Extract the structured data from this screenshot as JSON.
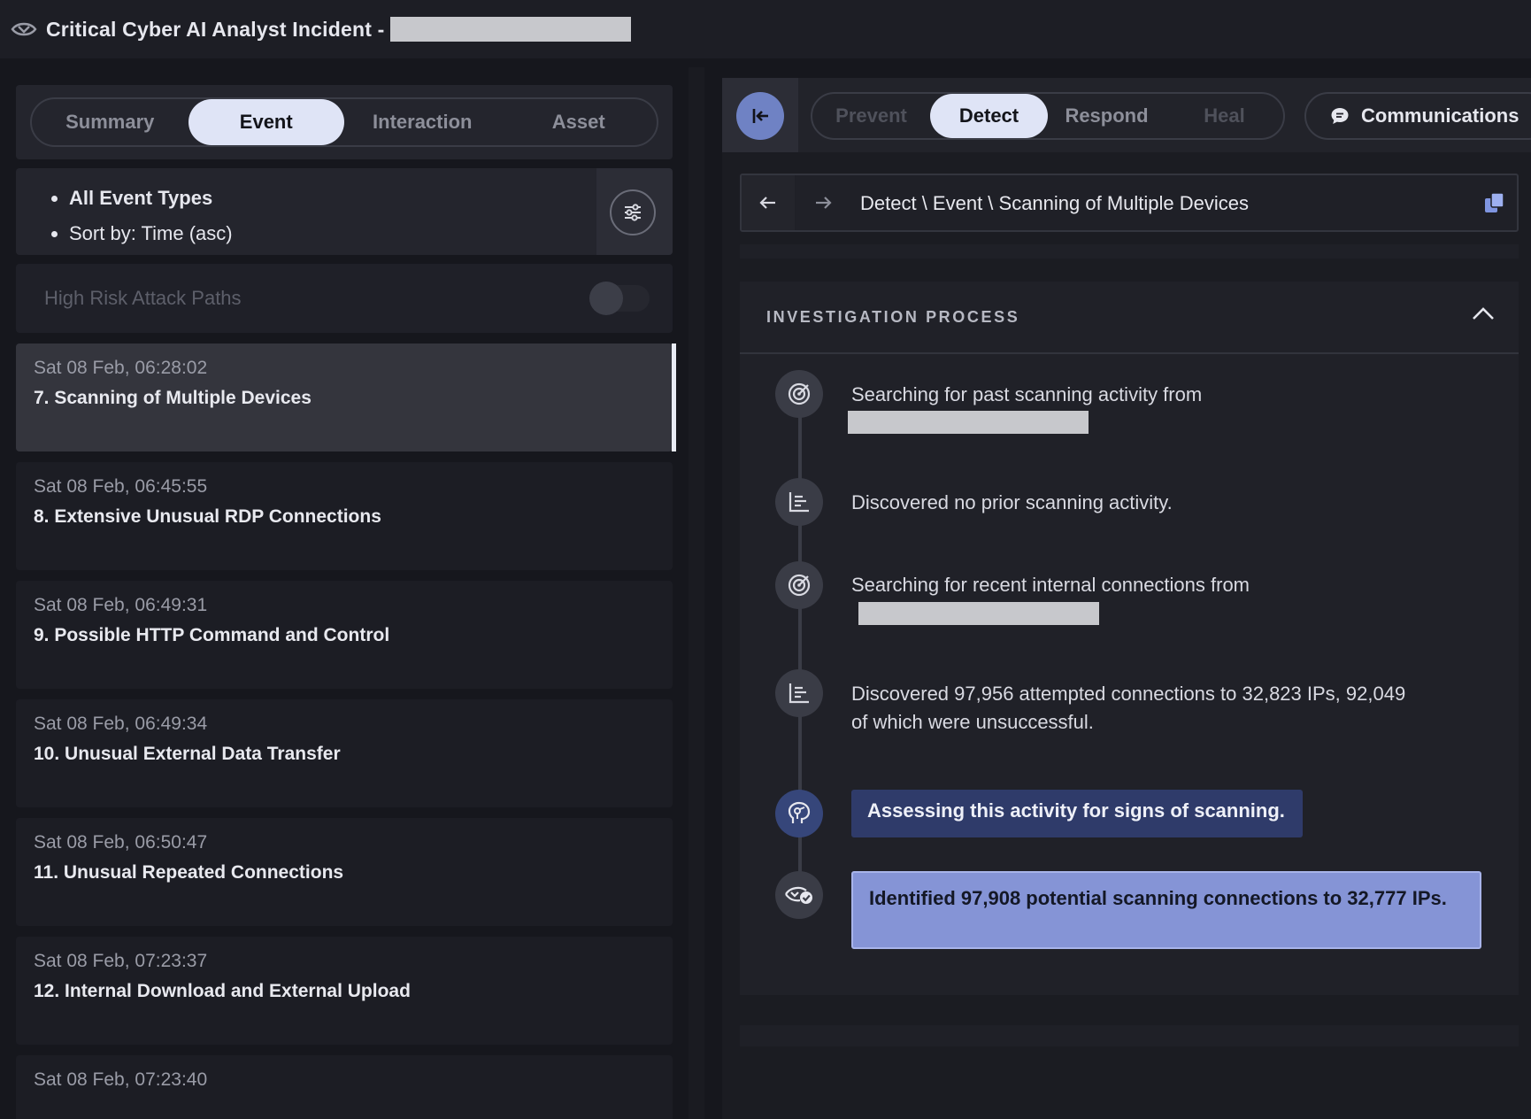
{
  "header": {
    "title": "Critical Cyber AI Analyst Incident -"
  },
  "left_tabs": [
    {
      "label": "Summary",
      "active": false
    },
    {
      "label": "Event",
      "active": true
    },
    {
      "label": "Interaction",
      "active": false
    },
    {
      "label": "Asset",
      "active": false
    }
  ],
  "filters": {
    "event_types": "All Event Types",
    "sort": "Sort by: Time (asc)"
  },
  "risk": {
    "label": "High Risk Attack Paths",
    "enabled": false
  },
  "events": [
    {
      "time": "Sat 08 Feb, 06:28:02",
      "name": "7. Scanning of Multiple Devices",
      "selected": true
    },
    {
      "time": "Sat 08 Feb, 06:45:55",
      "name": "8. Extensive Unusual RDP Connections"
    },
    {
      "time": "Sat 08 Feb, 06:49:31",
      "name": "9. Possible HTTP Command and Control"
    },
    {
      "time": "Sat 08 Feb, 06:49:34",
      "name": "10. Unusual External Data Transfer"
    },
    {
      "time": "Sat 08 Feb, 06:50:47",
      "name": "11. Unusual Repeated Connections"
    },
    {
      "time": "Sat 08 Feb, 07:23:37",
      "name": "12. Internal Download and External Upload"
    },
    {
      "time": "Sat 08 Feb, 07:23:40",
      "name": ""
    }
  ],
  "phases": [
    {
      "label": "Prevent",
      "state": "dim"
    },
    {
      "label": "Detect",
      "state": "active"
    },
    {
      "label": "Respond",
      "state": "normal"
    },
    {
      "label": "Heal",
      "state": "dim"
    }
  ],
  "communications": {
    "label": "Communications"
  },
  "breadcrumb": "Detect \\ Event \\ Scanning of Multiple Devices",
  "investigation": {
    "title": "INVESTIGATION PROCESS",
    "steps": [
      {
        "icon": "target-icon",
        "text": "Searching for past scanning activity from"
      },
      {
        "icon": "chart-icon",
        "text": "Discovered no prior scanning activity."
      },
      {
        "icon": "target-icon",
        "text": "Searching for recent internal connections from"
      },
      {
        "icon": "chart-icon",
        "text": "Discovered 97,956 attempted connections to 32,823 IPs, 92,049 of which were unsuccessful."
      },
      {
        "icon": "brain-icon",
        "text": "Assessing this activity for signs of scanning."
      },
      {
        "icon": "eye-check-icon",
        "text": "Identified 97,908 potential scanning connections to 32,777 IPs."
      }
    ]
  },
  "colors": {
    "accent": "#6f82c4",
    "highlight": "#8594d6",
    "active_tab": "#dfe4f6",
    "background": "#16171d"
  }
}
